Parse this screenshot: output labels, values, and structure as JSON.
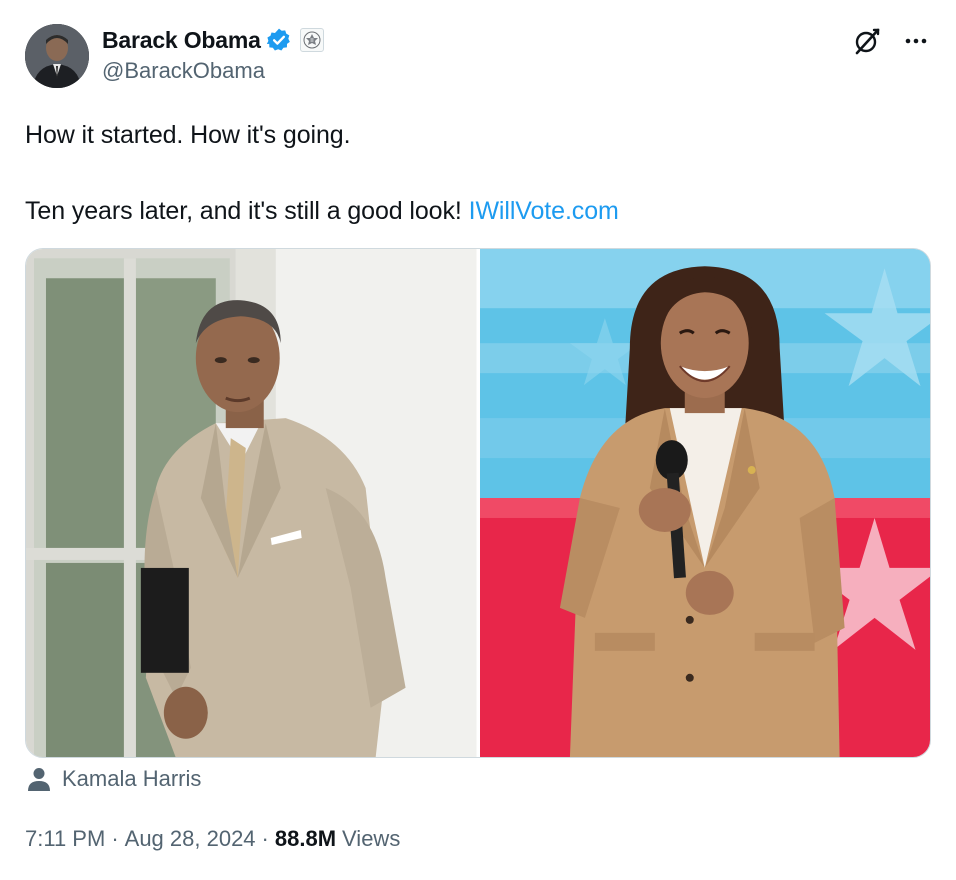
{
  "author": {
    "display_name": "Barack Obama",
    "handle": "@BarackObama",
    "verified_color": "#1d9bf0",
    "affiliate_badge": "us-seal-badge-icon"
  },
  "tweet": {
    "line1": "How it started. How it's going.",
    "line2_text": "Ten years later, and it's still a good look!",
    "link_text": "IWillVote.com",
    "link_color": "#1d9bf0"
  },
  "media": {
    "left_photo": "photo-man-in-tan-suit",
    "right_photo": "photo-woman-in-tan-suit-with-microphone"
  },
  "tagged_user": {
    "icon": "person-icon",
    "name": "Kamala Harris"
  },
  "meta": {
    "time": "7:11 PM",
    "separator": "·",
    "date": "Aug 28, 2024",
    "views_count": "88.8M",
    "views_label": "Views"
  },
  "icons": {
    "grok": "grok-icon",
    "more": "more-options-icon"
  }
}
